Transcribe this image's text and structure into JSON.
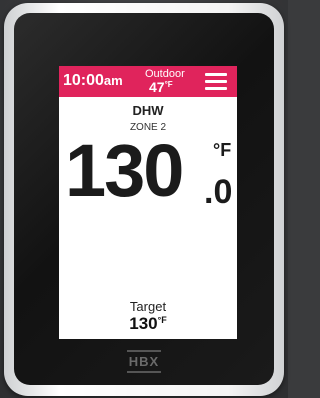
{
  "header": {
    "time": "10:00",
    "ampm": "am",
    "outdoor_label": "Outdoor",
    "outdoor_value": "47",
    "outdoor_unit": "°F"
  },
  "zone": {
    "name": "DHW",
    "sub": "ZONE 2"
  },
  "current": {
    "value": "130",
    "decimal": ".0",
    "unit": "°F"
  },
  "target": {
    "label": "Target",
    "value": "130",
    "unit": "°F"
  },
  "brand": {
    "logo_text": "HBX"
  },
  "colors": {
    "accent": "#e0245c",
    "screen_bg": "#ffffff"
  },
  "icons": {
    "menu": "hamburger-menu-icon"
  }
}
